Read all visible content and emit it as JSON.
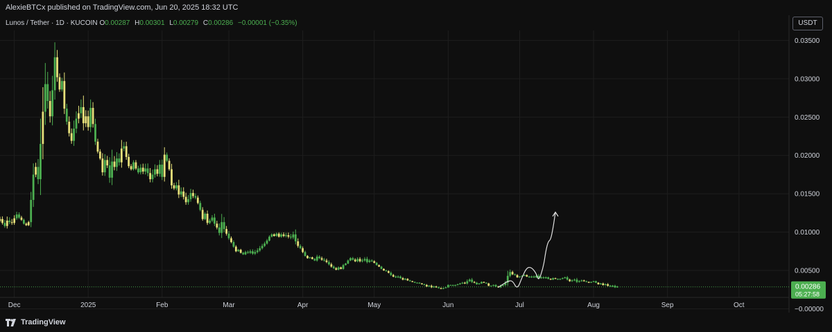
{
  "publish_line": "AlexieBTCx published on TradingView.com, Jun 20, 2025 18:32 UTC",
  "legend": {
    "symbol": "Lunos / Tether · 1D · KUCOIN",
    "o_label": "O",
    "o_value": "0.00287",
    "h_label": "H",
    "h_value": "0.00301",
    "l_label": "L",
    "l_value": "0.00279",
    "c_label": "C",
    "c_value": "0.00286",
    "change": "−0.00001 (−0.35%)"
  },
  "currency_button": "USDT",
  "brand": "TradingView",
  "colors": {
    "background": "#0f0f0f",
    "up": "#4caf50",
    "up_alt": "#e6e07a",
    "price_badge": "#4caf50",
    "grid": "#1e1e1e",
    "text": "#d1d4dc"
  },
  "chart_data": {
    "type": "candlestick",
    "x_range": [
      "2024-11-25",
      "2025-10-22"
    ],
    "ylim": [
      -0.0005,
      0.0363
    ],
    "y_ticks": [
      "0.03500",
      "0.03000",
      "0.02500",
      "0.02000",
      "0.01500",
      "0.01000",
      "0.00500",
      "−0.00000"
    ],
    "y_tick_values": [
      0.035,
      0.03,
      0.025,
      0.02,
      0.015,
      0.01,
      0.005,
      0.0
    ],
    "x_ticks": [
      {
        "label": "Dec",
        "date": "2024-12-01"
      },
      {
        "label": "2025",
        "date": "2025-01-01"
      },
      {
        "label": "Feb",
        "date": "2025-02-01"
      },
      {
        "label": "Mar",
        "date": "2025-03-01"
      },
      {
        "label": "Apr",
        "date": "2025-04-01"
      },
      {
        "label": "May",
        "date": "2025-05-01"
      },
      {
        "label": "Jun",
        "date": "2025-06-01"
      },
      {
        "label": "Jul",
        "date": "2025-07-01"
      },
      {
        "label": "Aug",
        "date": "2025-08-01"
      },
      {
        "label": "Sep",
        "date": "2025-09-01"
      },
      {
        "label": "Oct",
        "date": "2025-10-01"
      }
    ],
    "first_date": "2024-11-25",
    "closes": [
      0.0117,
      0.0112,
      0.0108,
      0.0115,
      0.0113,
      0.0112,
      0.0118,
      0.0123,
      0.0119,
      0.0116,
      0.0111,
      0.0109,
      0.0113,
      0.0142,
      0.0175,
      0.0185,
      0.0169,
      0.0215,
      0.0257,
      0.0293,
      0.0271,
      0.0251,
      0.0285,
      0.0328,
      0.0302,
      0.0286,
      0.0297,
      0.0261,
      0.0244,
      0.0229,
      0.0219,
      0.0235,
      0.0248,
      0.0255,
      0.0263,
      0.0242,
      0.0251,
      0.0237,
      0.0262,
      0.0241,
      0.0218,
      0.0205,
      0.0196,
      0.0178,
      0.0194,
      0.0187,
      0.0171,
      0.0192,
      0.0185,
      0.0196,
      0.0191,
      0.0209,
      0.0212,
      0.0198,
      0.0186,
      0.0182,
      0.0191,
      0.0183,
      0.0178,
      0.0184,
      0.0179,
      0.0183,
      0.0177,
      0.0169,
      0.0175,
      0.0182,
      0.0176,
      0.0188,
      0.0172,
      0.0201,
      0.0193,
      0.0182,
      0.0161,
      0.0157,
      0.0161,
      0.0149,
      0.0153,
      0.0146,
      0.0139,
      0.0143,
      0.0151,
      0.0147,
      0.0145,
      0.0138,
      0.0129,
      0.0117,
      0.0124,
      0.0112,
      0.0115,
      0.0119,
      0.0111,
      0.0106,
      0.0099,
      0.0113,
      0.0104,
      0.0098,
      0.0092,
      0.0087,
      0.0081,
      0.0075,
      0.0077,
      0.0073,
      0.0071,
      0.0074,
      0.0073,
      0.0075,
      0.0072,
      0.0074,
      0.0076,
      0.0079,
      0.0082,
      0.0085,
      0.0089,
      0.0094,
      0.0097,
      0.0095,
      0.0098,
      0.0094,
      0.0097,
      0.0095,
      0.0096,
      0.0094,
      0.0093,
      0.0097,
      0.0088,
      0.0082,
      0.0079,
      0.0074,
      0.0069,
      0.0066,
      0.0067,
      0.0065,
      0.0063,
      0.0068,
      0.0066,
      0.0064,
      0.0063,
      0.0061,
      0.0058,
      0.0055,
      0.0053,
      0.0051,
      0.0054,
      0.0052,
      0.0057,
      0.0059,
      0.0063,
      0.0066,
      0.0064,
      0.0062,
      0.0065,
      0.0062,
      0.0063,
      0.0065,
      0.0061,
      0.0063,
      0.0062,
      0.006,
      0.0057,
      0.0055,
      0.0052,
      0.005,
      0.0049,
      0.0047,
      0.0044,
      0.0042,
      0.0041,
      0.0042,
      0.004,
      0.0038,
      0.0039,
      0.0037,
      0.0036,
      0.0035,
      0.0034,
      0.0034,
      0.0033,
      0.0032,
      0.0031,
      0.0029,
      0.003,
      0.0028,
      0.0029,
      0.0028,
      0.0027,
      0.0026,
      0.0027,
      0.0028,
      0.0031,
      0.0031,
      0.003,
      0.0031,
      0.0032,
      0.0033,
      0.0034,
      0.0033,
      0.0036,
      0.0038,
      0.0035,
      0.0034,
      0.0032,
      0.0033,
      0.0035,
      0.0034,
      0.0033,
      0.003,
      0.003,
      0.0031,
      0.0029,
      0.0028,
      0.003,
      0.0031,
      0.0034,
      0.0043,
      0.0048,
      0.0045,
      0.0044,
      0.0041,
      0.0042,
      0.0043,
      0.0044,
      0.0042,
      0.0041,
      0.0042,
      0.0041,
      0.0043,
      0.004,
      0.0041,
      0.004,
      0.0041,
      0.0039,
      0.0038,
      0.004,
      0.0039,
      0.0038,
      0.0039,
      0.004,
      0.0041,
      0.0038,
      0.0036,
      0.0037,
      0.0038,
      0.0035,
      0.0036,
      0.0037,
      0.0036,
      0.0035,
      0.0034,
      0.0035,
      0.0036,
      0.0034,
      0.0032,
      0.0033,
      0.0031,
      0.0032,
      0.003,
      0.0029,
      0.003,
      0.0028,
      0.0029
    ],
    "current_price": "0.00286",
    "current_value": 0.00286,
    "countdown": "05:27:58",
    "projection": [
      {
        "date": "2025-06-22",
        "value": 0.0028
      },
      {
        "date": "2025-06-24",
        "value": 0.0032
      },
      {
        "date": "2025-06-26",
        "value": 0.0036
      },
      {
        "date": "2025-06-28",
        "value": 0.0037
      },
      {
        "date": "2025-06-30",
        "value": 0.0025
      },
      {
        "date": "2025-07-02",
        "value": 0.0041
      },
      {
        "date": "2025-07-04",
        "value": 0.0054
      },
      {
        "date": "2025-07-06",
        "value": 0.0054
      },
      {
        "date": "2025-07-08",
        "value": 0.0046
      },
      {
        "date": "2025-07-09",
        "value": 0.0036
      },
      {
        "date": "2025-07-11",
        "value": 0.0055
      },
      {
        "date": "2025-07-12",
        "value": 0.0076
      },
      {
        "date": "2025-07-13",
        "value": 0.0088
      },
      {
        "date": "2025-07-14",
        "value": 0.009
      },
      {
        "date": "2025-07-15",
        "value": 0.0105
      },
      {
        "date": "2025-07-16",
        "value": 0.0126
      }
    ]
  }
}
